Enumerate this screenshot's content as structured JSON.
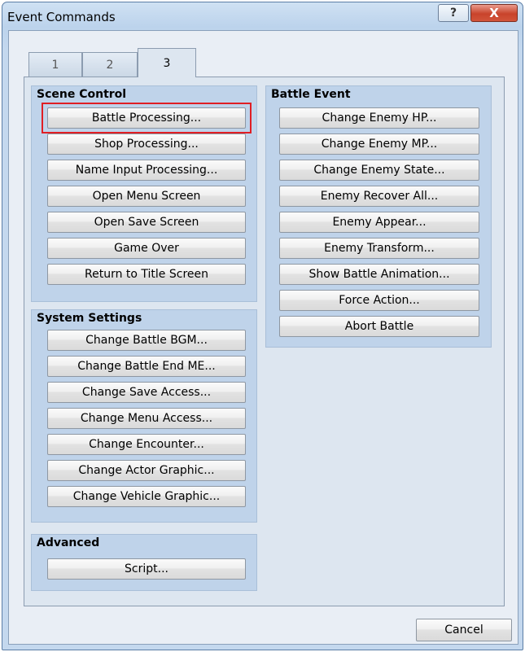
{
  "window": {
    "title": "Event Commands",
    "help_label": "?",
    "close_label": "X"
  },
  "tabs": [
    {
      "label": "1"
    },
    {
      "label": "2"
    },
    {
      "label": "3"
    }
  ],
  "scene_control": {
    "title": "Scene Control",
    "buttons": [
      "Battle Processing...",
      "Shop Processing...",
      "Name Input Processing...",
      "Open Menu Screen",
      "Open Save Screen",
      "Game Over",
      "Return to Title Screen"
    ]
  },
  "system_settings": {
    "title": "System Settings",
    "buttons": [
      "Change Battle BGM...",
      "Change Battle End ME...",
      "Change Save Access...",
      "Change Menu Access...",
      "Change Encounter...",
      "Change Actor Graphic...",
      "Change Vehicle Graphic..."
    ]
  },
  "advanced": {
    "title": "Advanced",
    "buttons": [
      "Script..."
    ]
  },
  "battle_event": {
    "title": "Battle Event",
    "buttons": [
      "Change Enemy HP...",
      "Change Enemy MP...",
      "Change Enemy State...",
      "Enemy Recover All...",
      "Enemy Appear...",
      "Enemy Transform...",
      "Show Battle Animation...",
      "Force Action...",
      "Abort Battle"
    ]
  },
  "footer": {
    "cancel_label": "Cancel"
  },
  "colors": {
    "highlight": "#e01e24",
    "group_bg": "#bfd3ea",
    "panel_bg": "#dde6f0"
  }
}
